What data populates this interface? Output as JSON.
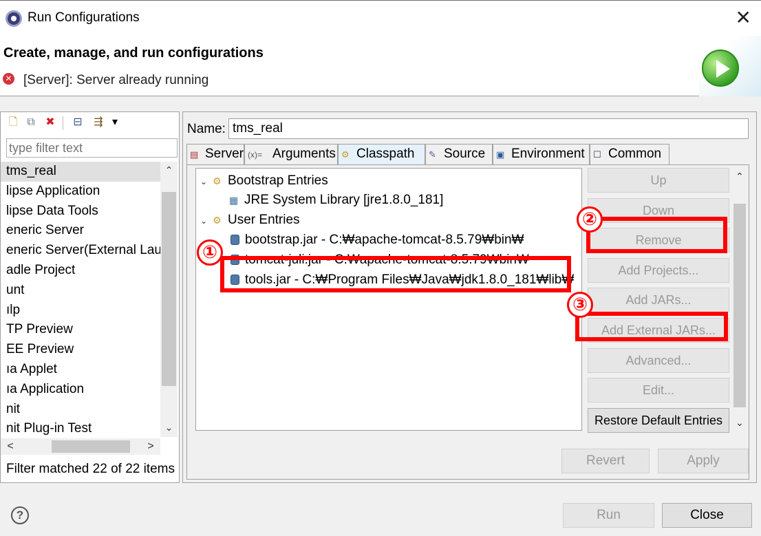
{
  "window": {
    "title": "Run Configurations",
    "close_glyph": "✕"
  },
  "header": {
    "title": "Create, manage, and run configurations",
    "error_glyph": "✕",
    "message": "[Server]: Server already running"
  },
  "left": {
    "toolbar": [
      {
        "icon": "new-config-icon",
        "glyph": "🗋"
      },
      {
        "icon": "duplicate-icon",
        "glyph": "⧉"
      },
      {
        "icon": "delete-icon",
        "glyph": "✖"
      },
      {
        "icon": "collapse-all-icon",
        "glyph": "⊟"
      },
      {
        "icon": "filter-icon",
        "glyph": "⇶"
      },
      {
        "icon": "view-menu-icon",
        "glyph": "▾"
      }
    ],
    "filter_placeholder": "type filter text",
    "items": [
      "tms_real",
      "lipse Application",
      "lipse Data Tools",
      "eneric Server",
      "eneric Server(External Laun",
      "adle Project",
      "unt",
      "ılp",
      "TP Preview",
      "EE Preview",
      "ıa Applet",
      "ıa Application",
      "nit",
      "nit Plug-in Test"
    ],
    "selected_index": 0,
    "filter_status": "Filter matched 22 of 22 items"
  },
  "right": {
    "name_label": "Name:",
    "name_value": "tms_real",
    "tabs": [
      {
        "label": "Server",
        "icon": "server-icon",
        "glyph": "▤"
      },
      {
        "label": "Arguments",
        "icon": "arguments-icon",
        "glyph": "(x)="
      },
      {
        "label": "Classpath",
        "icon": "classpath-icon",
        "glyph": "⚙",
        "active": true
      },
      {
        "label": "Source",
        "icon": "source-icon",
        "glyph": "✎"
      },
      {
        "label": "Environment",
        "icon": "environment-icon",
        "glyph": "▣"
      },
      {
        "label": "Common",
        "icon": "common-icon",
        "glyph": "☐"
      }
    ],
    "tree": {
      "bootstrap": "Bootstrap Entries",
      "jre": "JRE System Library [jre1.8.0_181]",
      "user": "User Entries",
      "entries": [
        "bootstrap.jar - C:₩apache-tomcat-8.5.79₩bin₩",
        "tomcat-juli.jar - C:₩apache-tomcat-8.5.79₩bin₩",
        "tools.jar - C:₩Program Files₩Java₩jdk1.8.0_181₩lib₩"
      ]
    },
    "buttons": {
      "up": "Up",
      "down": "Down",
      "remove": "Remove",
      "add_projects": "Add Projects...",
      "add_jars": "Add JARs...",
      "add_external_jars": "Add External JARs...",
      "advanced": "Advanced...",
      "edit": "Edit...",
      "restore": "Restore Default Entries"
    },
    "revert": "Revert",
    "apply": "Apply"
  },
  "footer": {
    "help": "?",
    "run": "Run",
    "close": "Close"
  },
  "annotations": {
    "one": "①",
    "two": "②",
    "three": "③",
    "color": "#ff0000"
  }
}
